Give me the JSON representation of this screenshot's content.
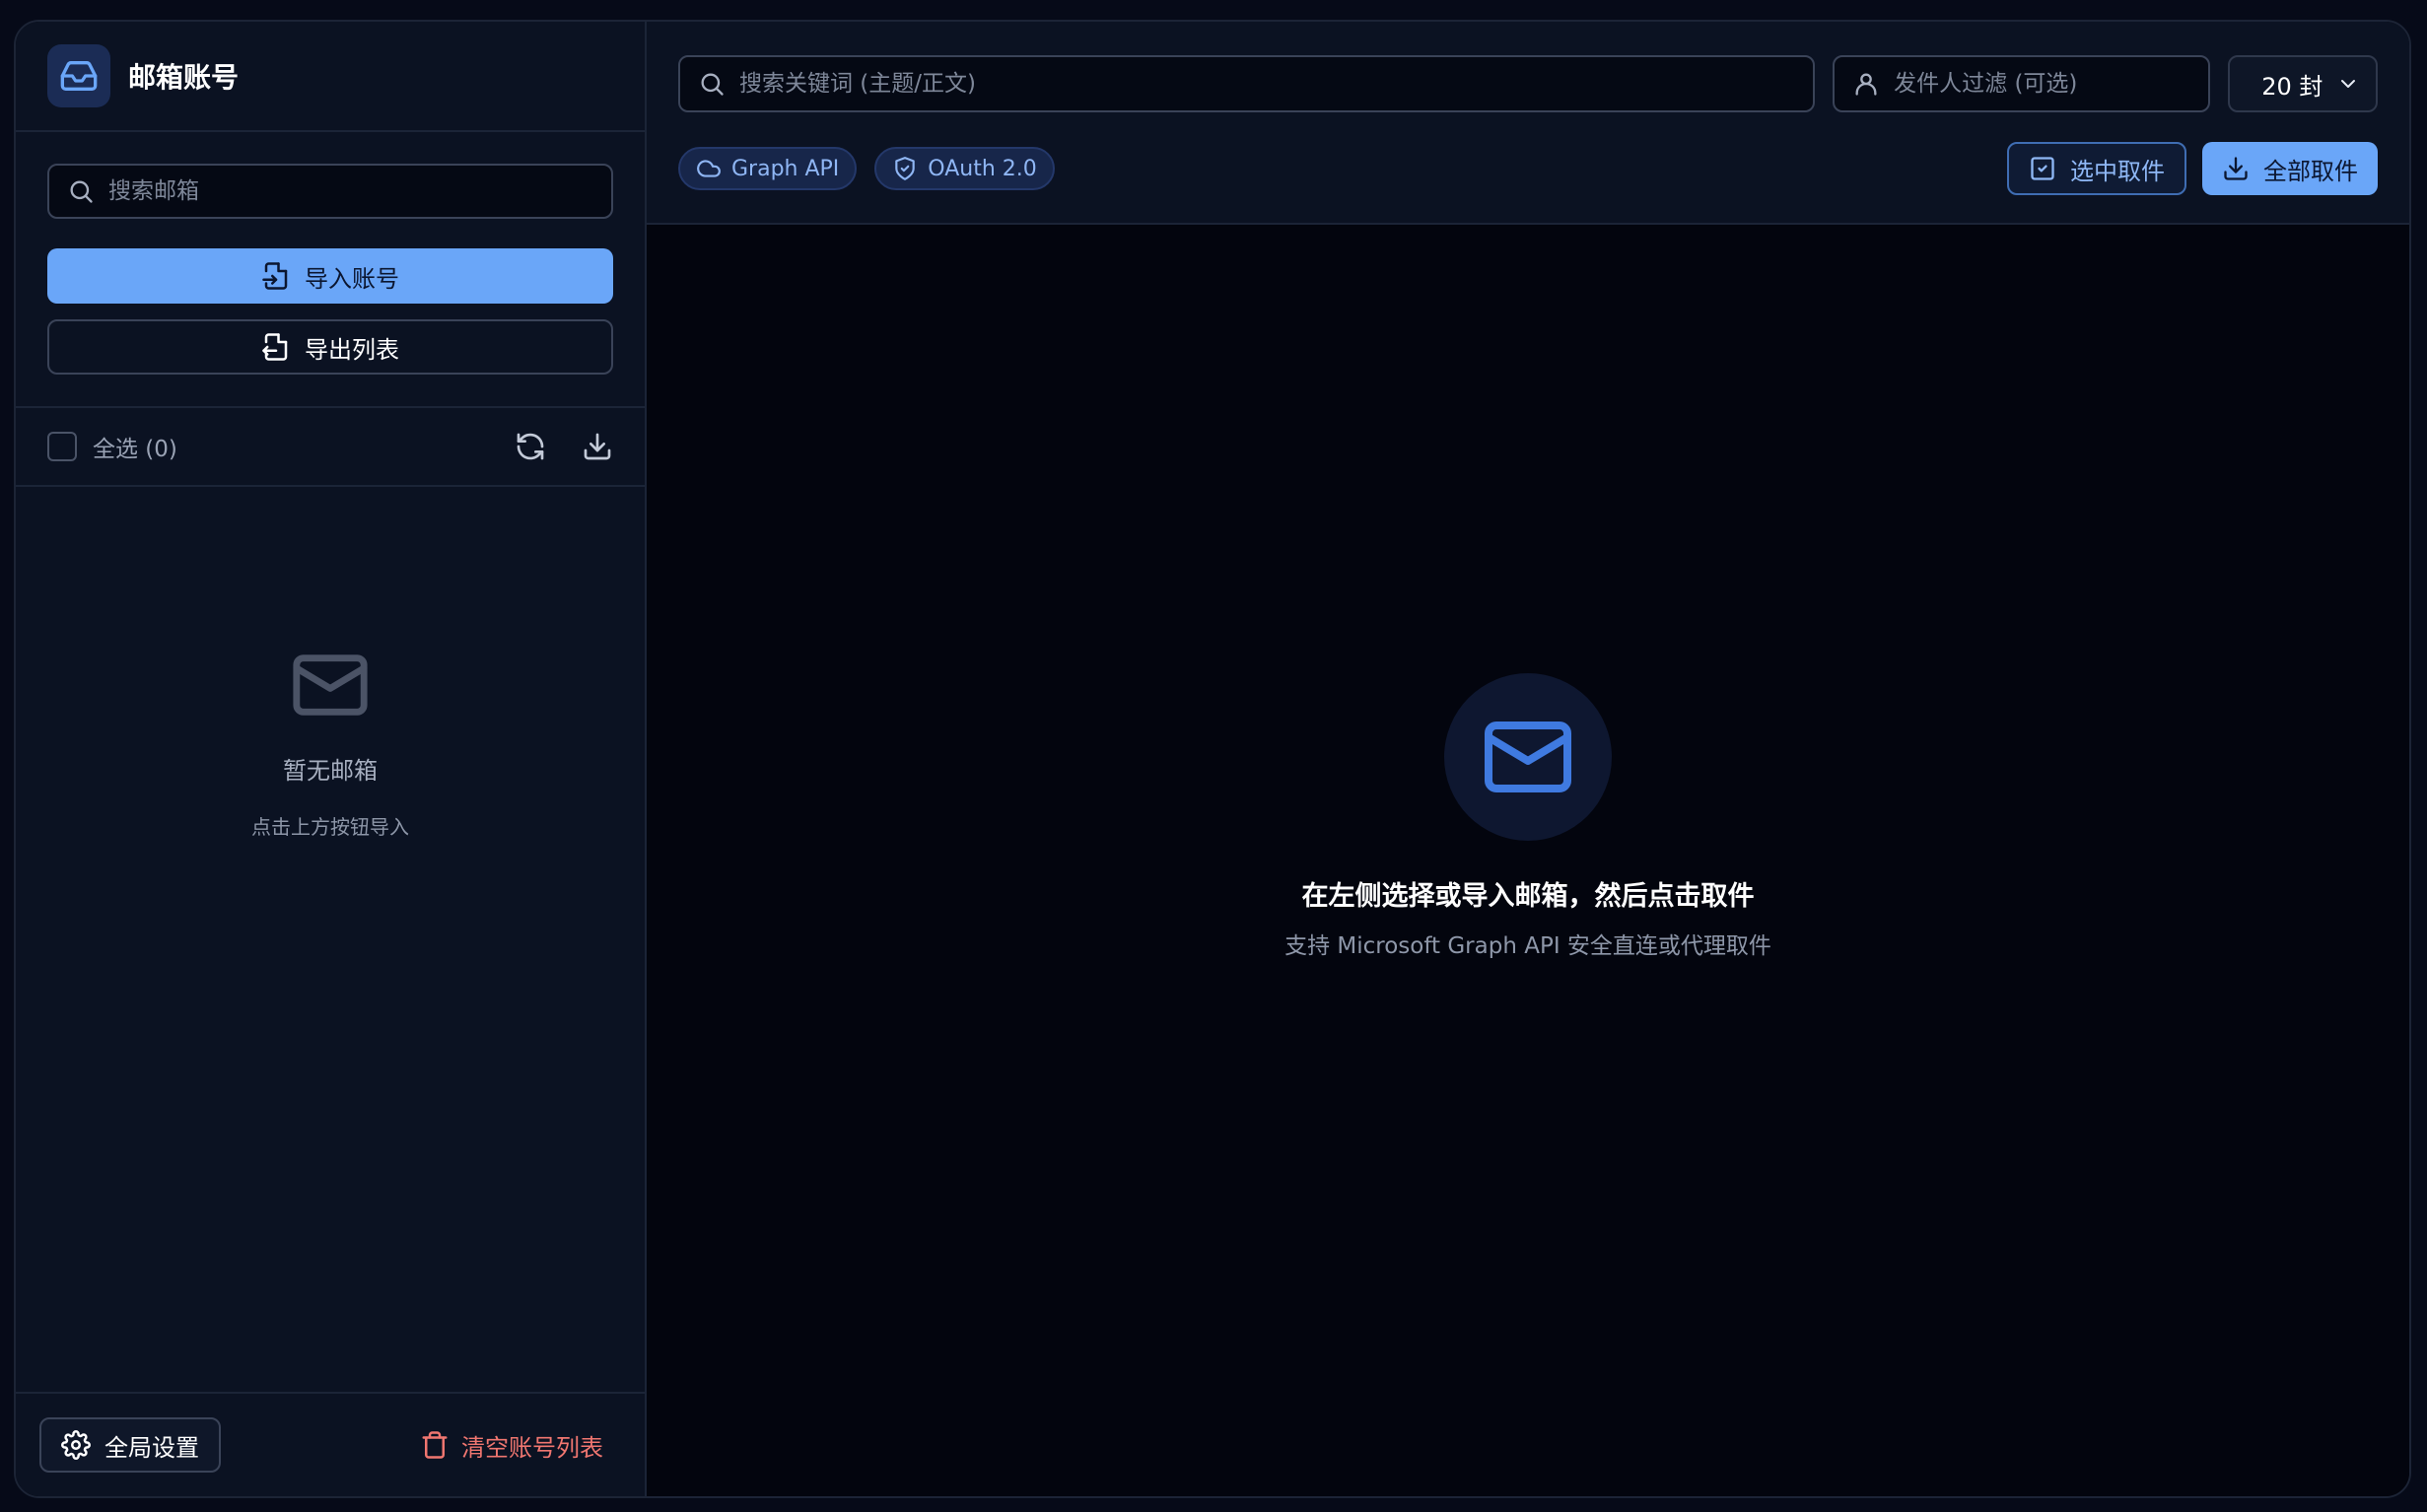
{
  "sidebar": {
    "title": "邮箱账号",
    "search_placeholder": "搜索邮箱",
    "import_label": "导入账号",
    "export_label": "导出列表",
    "select_all_label": "全选 (0)",
    "empty_title": "暂无邮箱",
    "empty_sub": "点击上方按钮导入",
    "settings_label": "全局设置",
    "clear_label": "清空账号列表"
  },
  "toolbar": {
    "keyword_placeholder": "搜索关键词 (主题/正文)",
    "sender_placeholder": "发件人过滤 (可选)",
    "count_value": "20 封",
    "badges": [
      "Graph API",
      "OAuth 2.0"
    ],
    "fetch_selected_label": "选中取件",
    "fetch_all_label": "全部取件"
  },
  "content": {
    "title": "在左侧选择或导入邮箱，然后点击取件",
    "subtitle": "支持 Microsoft Graph API 安全直连或代理取件"
  },
  "colors": {
    "accent": "#6aa6f8",
    "danger": "#f07670",
    "background": "#03050e",
    "panel": "#0b1222"
  }
}
